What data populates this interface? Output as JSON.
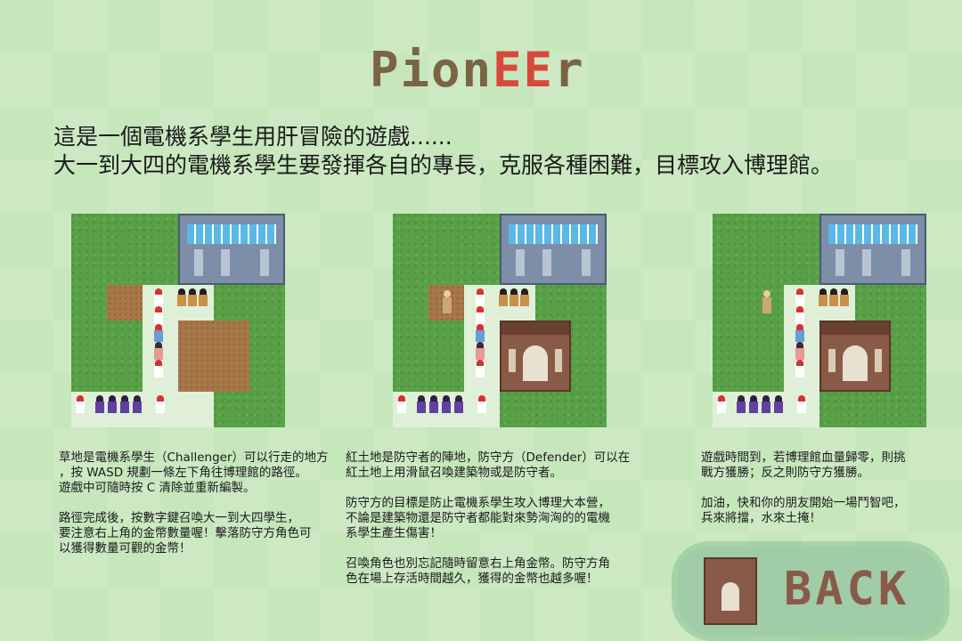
{
  "logo": {
    "part1": "Pion",
    "part2": "EE",
    "part3": "r"
  },
  "intro": {
    "line1": "這是一個電機系學生用肝冒險的遊戲......",
    "line2": "大一到大四的電機系學生要發揮各自的專長，克服各種困難，目標攻入博理館。"
  },
  "sections": [
    {
      "text": "草地是電機系學生（Challenger）可以行走的地方\n，按 WASD 規劃一條左下角往博理館的路徑。\n遊戲中可隨時按 C 清除並重新編製。\n\n路徑完成後，按數字鍵召喚大一到大四學生，\n要注意右上角的金幣數量喔！擊落防守方角色可\n以獲得數量可觀的金幣！"
    },
    {
      "text": "紅土地是防守者的陣地，防守方（Defender）可以在\n紅土地上用滑鼠召喚建築物或是防守者。\n\n防守方的目標是防止電機系學生攻入博理大本營，\n不論是建築物還是防守者都能對來勢洶洶的的電機\n系學生產生傷害！\n\n召喚角色也別忘記隨時留意右上角金幣。防守方角\n色在場上存活時間越久，獲得的金幣也越多喔！"
    },
    {
      "text": "遊戲時間到，若博理館血量歸零，則挑\n戰方獲勝；反之則防守方獲勝。\n\n加油，快和你的朋友開始一場鬥智吧，\n兵來將擋，水來土掩！"
    }
  ],
  "back_button": {
    "label": "BACK"
  },
  "colors": {
    "grass": "#58a046",
    "dirt": "#a87848",
    "accent_red": "#d8483a",
    "brown": "#7a6444"
  }
}
